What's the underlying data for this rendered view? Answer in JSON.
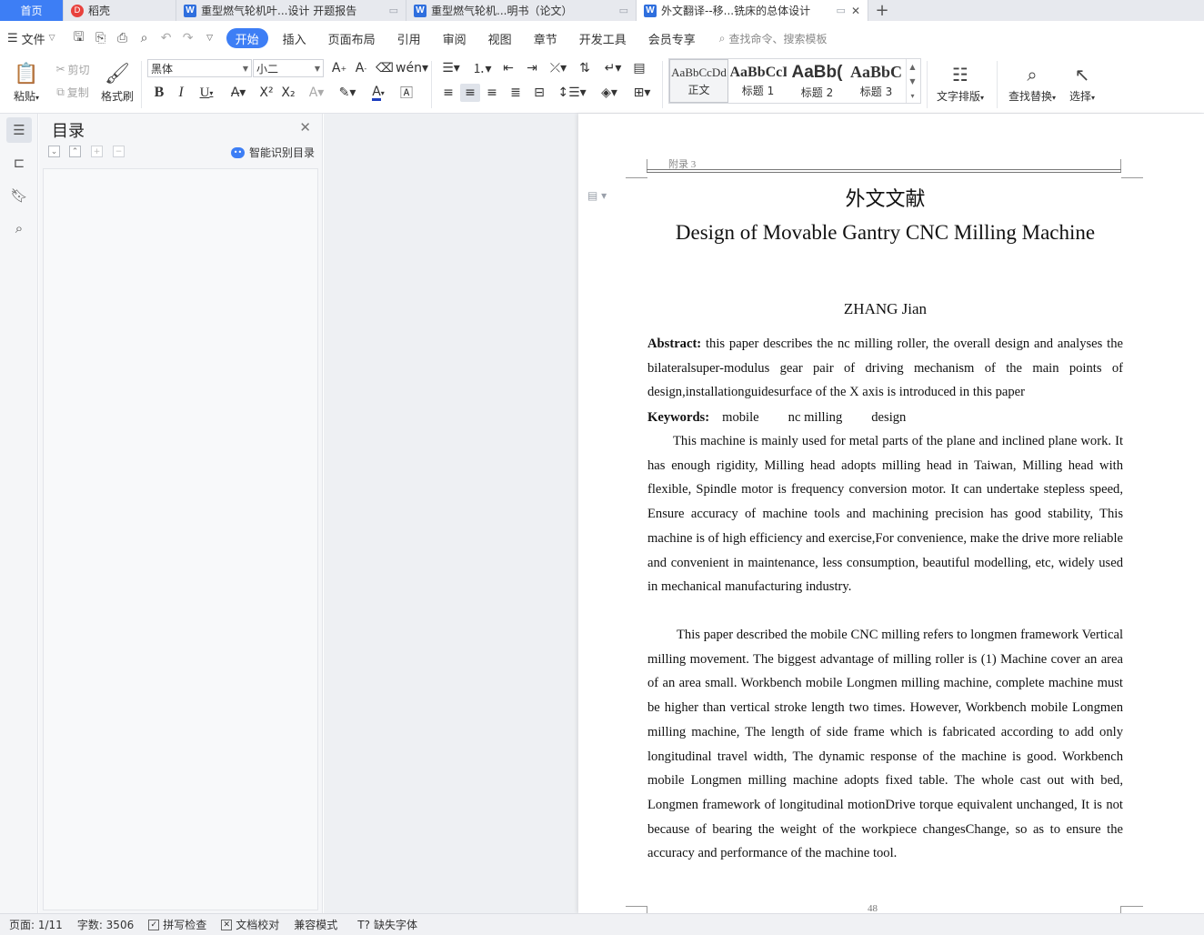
{
  "tabs": [
    {
      "label": "首页"
    },
    {
      "label": "稻壳"
    },
    {
      "label": "重型燃气轮机叶...设计 开题报告"
    },
    {
      "label": "重型燃气轮机...明书（论文）"
    },
    {
      "label": "外文翻译--移...铣床的总体设计"
    }
  ],
  "menu": {
    "file": "文件",
    "tabs": [
      "开始",
      "插入",
      "页面布局",
      "引用",
      "审阅",
      "视图",
      "章节",
      "开发工具",
      "会员专享"
    ],
    "search": "查找命令、搜索模板"
  },
  "ribbon": {
    "paste": "粘贴",
    "cut": "剪切",
    "copy": "复制",
    "format_painter": "格式刷",
    "font_name": "黑体",
    "font_size": "小二",
    "styles": [
      {
        "sample": "AaBbCcDd",
        "label": "正文"
      },
      {
        "sample": "AaBbCcI",
        "label": "标题 1"
      },
      {
        "sample": "AaBb(",
        "label": "标题 2"
      },
      {
        "sample": "AaBbC",
        "label": "标题 3"
      }
    ],
    "text_layout": "文字排版",
    "find_replace": "查找替换",
    "select": "选择"
  },
  "toc": {
    "title": "目录",
    "smart": "智能识别目录"
  },
  "document": {
    "header_label": "附录 3",
    "title_cn": "外文文献",
    "title_en": "Design of Movable Gantry CNC Milling Machine",
    "author": "ZHANG Jian",
    "abstract_label": "Abstract:",
    "abstract_text": " this paper describes the nc milling roller, the overall design and analyses the bilateralsuper-modulus gear pair of driving mechanism of the main points of design,installationguidesurface of the X axis is introduced in this paper",
    "keywords_label": "Keywords:",
    "keywords": [
      "mobile",
      "nc milling",
      "design"
    ],
    "para1": "This machine is mainly used for metal parts of the plane and inclined plane work. It has enough rigidity, Milling head adopts milling head in Taiwan, Milling head with flexible, Spindle motor is frequency conversion motor. It can undertake stepless speed, Ensure accuracy of machine tools and machining precision has good stability, This machine is of high efficiency and exercise,For convenience, make the drive more reliable and convenient in maintenance, less consumption, beautiful modelling, etc, widely used in mechanical manufacturing industry.",
    "para2": "This paper described the mobile CNC milling refers to longmen framework Vertical milling movement. The biggest advantage of milling roller is (1) Machine cover an area of an area small. Workbench mobile Longmen milling machine, complete machine must be higher than vertical stroke length two times. However, Workbench mobile Longmen milling machine, The length of side frame which is fabricated according to add only longitudinal travel width, The dynamic response of the machine is good. Workbench mobile Longmen milling machine adopts fixed table. The whole cast out with bed, Longmen framework of longitudinal motionDrive torque equivalent unchanged, It is not because of bearing the weight of the workpiece changesChange, so as to ensure the accuracy and performance of the machine tool.",
    "page_number": "48"
  },
  "status": {
    "page": "页面: 1/11",
    "words": "字数: 3506",
    "spell": "拼写检查",
    "proof": "文档校对",
    "compat": "兼容模式",
    "missing_font": "缺失字体"
  },
  "colors": {
    "accent": "#3d7ef5"
  }
}
